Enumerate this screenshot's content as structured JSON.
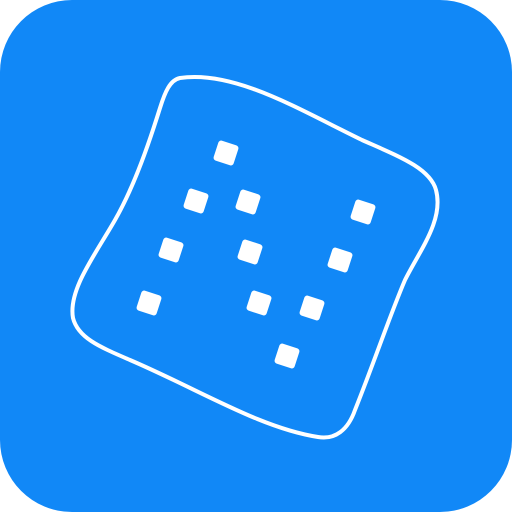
{
  "icon": {
    "name": "dice-app-icon",
    "glyph": "tilted-square-grid-icon",
    "background_color": "#1188F7",
    "foreground_color": "#FFFFFF"
  }
}
